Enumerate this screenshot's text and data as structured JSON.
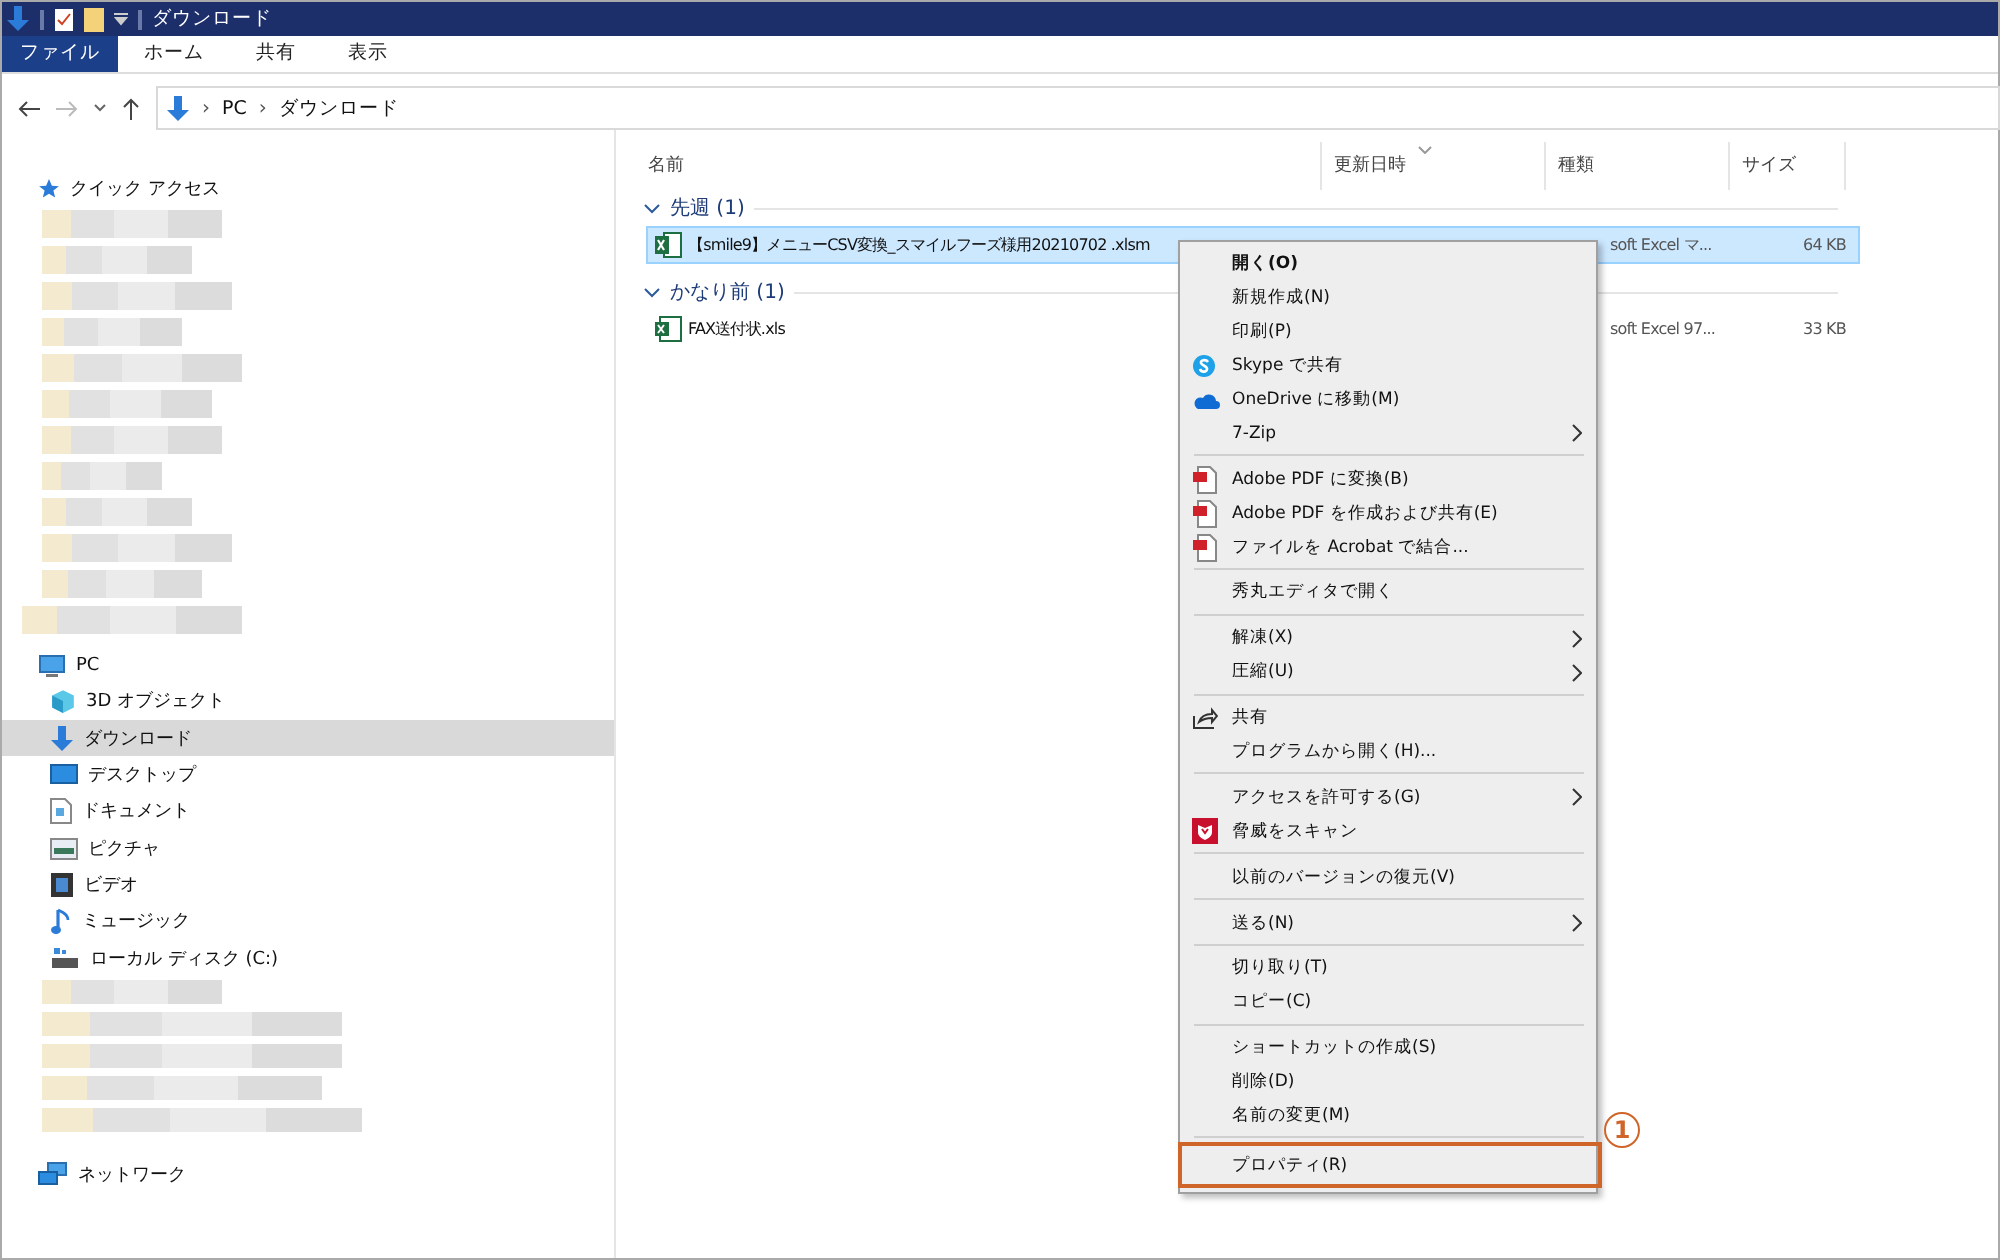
{
  "window": {
    "title": "ダウンロード"
  },
  "ribbon_tabs": [
    {
      "label": "ファイル",
      "selected": true
    },
    {
      "label": "ホーム",
      "selected": false
    },
    {
      "label": "共有",
      "selected": false
    },
    {
      "label": "表示",
      "selected": false
    }
  ],
  "address": {
    "segments": [
      {
        "chevron": "›",
        "label": "PC"
      },
      {
        "chevron": "›",
        "label": "ダウンロード"
      }
    ]
  },
  "sidebar": {
    "items": [
      {
        "label": "クイック アクセス",
        "selected": false
      },
      {
        "label": "PC",
        "selected": false,
        "children": [
          {
            "label": "3D オブジェクト",
            "selected": false
          },
          {
            "label": "ダウンロード",
            "selected": true
          },
          {
            "label": "デスクトップ",
            "selected": false
          },
          {
            "label": "ドキュメント",
            "selected": false
          },
          {
            "label": "ピクチャ",
            "selected": false
          },
          {
            "label": "ビデオ",
            "selected": false
          },
          {
            "label": "ミュージック",
            "selected": false
          },
          {
            "label": "ローカル ディスク (C:)",
            "selected": false
          }
        ]
      },
      {
        "label": "ネットワーク",
        "selected": false
      }
    ]
  },
  "table": {
    "columns": [
      "名前",
      "更新日時",
      "種類",
      "サイズ"
    ],
    "groups": [
      {
        "label": "先週 (1)",
        "rows": [
          {
            "name": "【smile9】メニューCSV変換_スマイルフーズ様用20210702 .xlsm",
            "type": "soft Excel マ...",
            "size": "64 KB",
            "selected": true
          }
        ]
      },
      {
        "label": "かなり前 (1)",
        "rows": [
          {
            "name": "FAX送付状.xls",
            "type": "soft Excel 97...",
            "size": "33 KB",
            "selected": false
          }
        ]
      }
    ]
  },
  "context_menu": {
    "items": [
      {
        "kind": "plain",
        "label": "開く(O)",
        "default": true,
        "submenu": false,
        "highlighted": false
      },
      {
        "kind": "plain",
        "label": "新規作成(N)",
        "default": false,
        "submenu": false,
        "highlighted": false
      },
      {
        "kind": "plain",
        "label": "印刷(P)",
        "default": false,
        "submenu": false,
        "highlighted": false
      },
      {
        "kind": "skype",
        "label": "Skype で共有",
        "default": false,
        "submenu": false,
        "highlighted": false
      },
      {
        "kind": "onedrive",
        "label": "OneDrive に移動(M)",
        "default": false,
        "submenu": false,
        "highlighted": false
      },
      {
        "kind": "plain",
        "label": "7-Zip",
        "default": false,
        "submenu": true,
        "highlighted": false
      },
      {
        "kind": "separator"
      },
      {
        "kind": "pdf",
        "label": "Adobe PDF に変換(B)",
        "default": false,
        "submenu": false,
        "highlighted": false
      },
      {
        "kind": "pdf",
        "label": "Adobe PDF を作成および共有(E)",
        "default": false,
        "submenu": false,
        "highlighted": false
      },
      {
        "kind": "pdf",
        "label": "ファイルを Acrobat で結合...",
        "default": false,
        "submenu": false,
        "highlighted": false
      },
      {
        "kind": "separator"
      },
      {
        "kind": "plain",
        "label": "秀丸エディタで開く",
        "default": false,
        "submenu": false,
        "highlighted": false
      },
      {
        "kind": "separator"
      },
      {
        "kind": "plain",
        "label": "解凍(X)",
        "default": false,
        "submenu": true,
        "highlighted": false
      },
      {
        "kind": "plain",
        "label": "圧縮(U)",
        "default": false,
        "submenu": true,
        "highlighted": false
      },
      {
        "kind": "separator"
      },
      {
        "kind": "share",
        "label": "共有",
        "default": false,
        "submenu": false,
        "highlighted": false
      },
      {
        "kind": "plain",
        "label": "プログラムから開く(H)...",
        "default": false,
        "submenu": false,
        "highlighted": false
      },
      {
        "kind": "separator"
      },
      {
        "kind": "plain",
        "label": "アクセスを許可する(G)",
        "default": false,
        "submenu": true,
        "highlighted": false
      },
      {
        "kind": "shield",
        "label": "脅威をスキャン",
        "default": false,
        "submenu": false,
        "highlighted": false
      },
      {
        "kind": "separator"
      },
      {
        "kind": "plain",
        "label": "以前のバージョンの復元(V)",
        "default": false,
        "submenu": false,
        "highlighted": false
      },
      {
        "kind": "separator"
      },
      {
        "kind": "plain",
        "label": "送る(N)",
        "default": false,
        "submenu": true,
        "highlighted": false
      },
      {
        "kind": "separator"
      },
      {
        "kind": "plain",
        "label": "切り取り(T)",
        "default": false,
        "submenu": false,
        "highlighted": false
      },
      {
        "kind": "plain",
        "label": "コピー(C)",
        "default": false,
        "submenu": false,
        "highlighted": false
      },
      {
        "kind": "separator"
      },
      {
        "kind": "plain",
        "label": "ショートカットの作成(S)",
        "default": false,
        "submenu": false,
        "highlighted": false
      },
      {
        "kind": "plain",
        "label": "削除(D)",
        "default": false,
        "submenu": false,
        "highlighted": false
      },
      {
        "kind": "plain",
        "label": "名前の変更(M)",
        "default": false,
        "submenu": false,
        "highlighted": false
      },
      {
        "kind": "separator"
      },
      {
        "kind": "plain",
        "label": "プロパティ(R)",
        "default": false,
        "submenu": false,
        "highlighted": true
      }
    ]
  },
  "callout": {
    "label": "1"
  }
}
